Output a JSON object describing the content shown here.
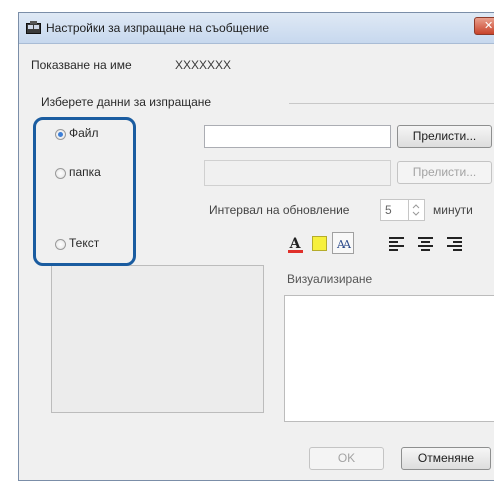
{
  "window": {
    "title": "Настройки за изпращане на съобщение",
    "close_glyph": "✕"
  },
  "display_name": {
    "label": "Показване на име",
    "value": "XXXXXXX"
  },
  "group": {
    "label": "Изберете данни за изпращане"
  },
  "options": {
    "file": {
      "label": "Файл",
      "selected": true
    },
    "folder": {
      "label": "папка",
      "selected": false
    },
    "text": {
      "label": "Текст",
      "selected": false
    }
  },
  "browse_file_label": "Прелисти...",
  "browse_folder_label": "Прелисти...",
  "interval": {
    "label": "Интервал на обновление",
    "value": "5",
    "unit": "минути"
  },
  "format": {
    "text_color_glyph": "A",
    "fill_color": "#f7f03c",
    "font_size_glyph": "AA",
    "align_left_icon": "align-left-icon",
    "align_center_icon": "align-center-icon",
    "align_right_icon": "align-right-icon"
  },
  "preview": {
    "label": "Визуализиране"
  },
  "footer": {
    "ok_label": "OK",
    "cancel_label": "Отменяне"
  },
  "colors": {
    "highlight": "#1a5ca0",
    "radio_selected": "#3d7fd6",
    "text_color_underline": "#e0302a"
  }
}
